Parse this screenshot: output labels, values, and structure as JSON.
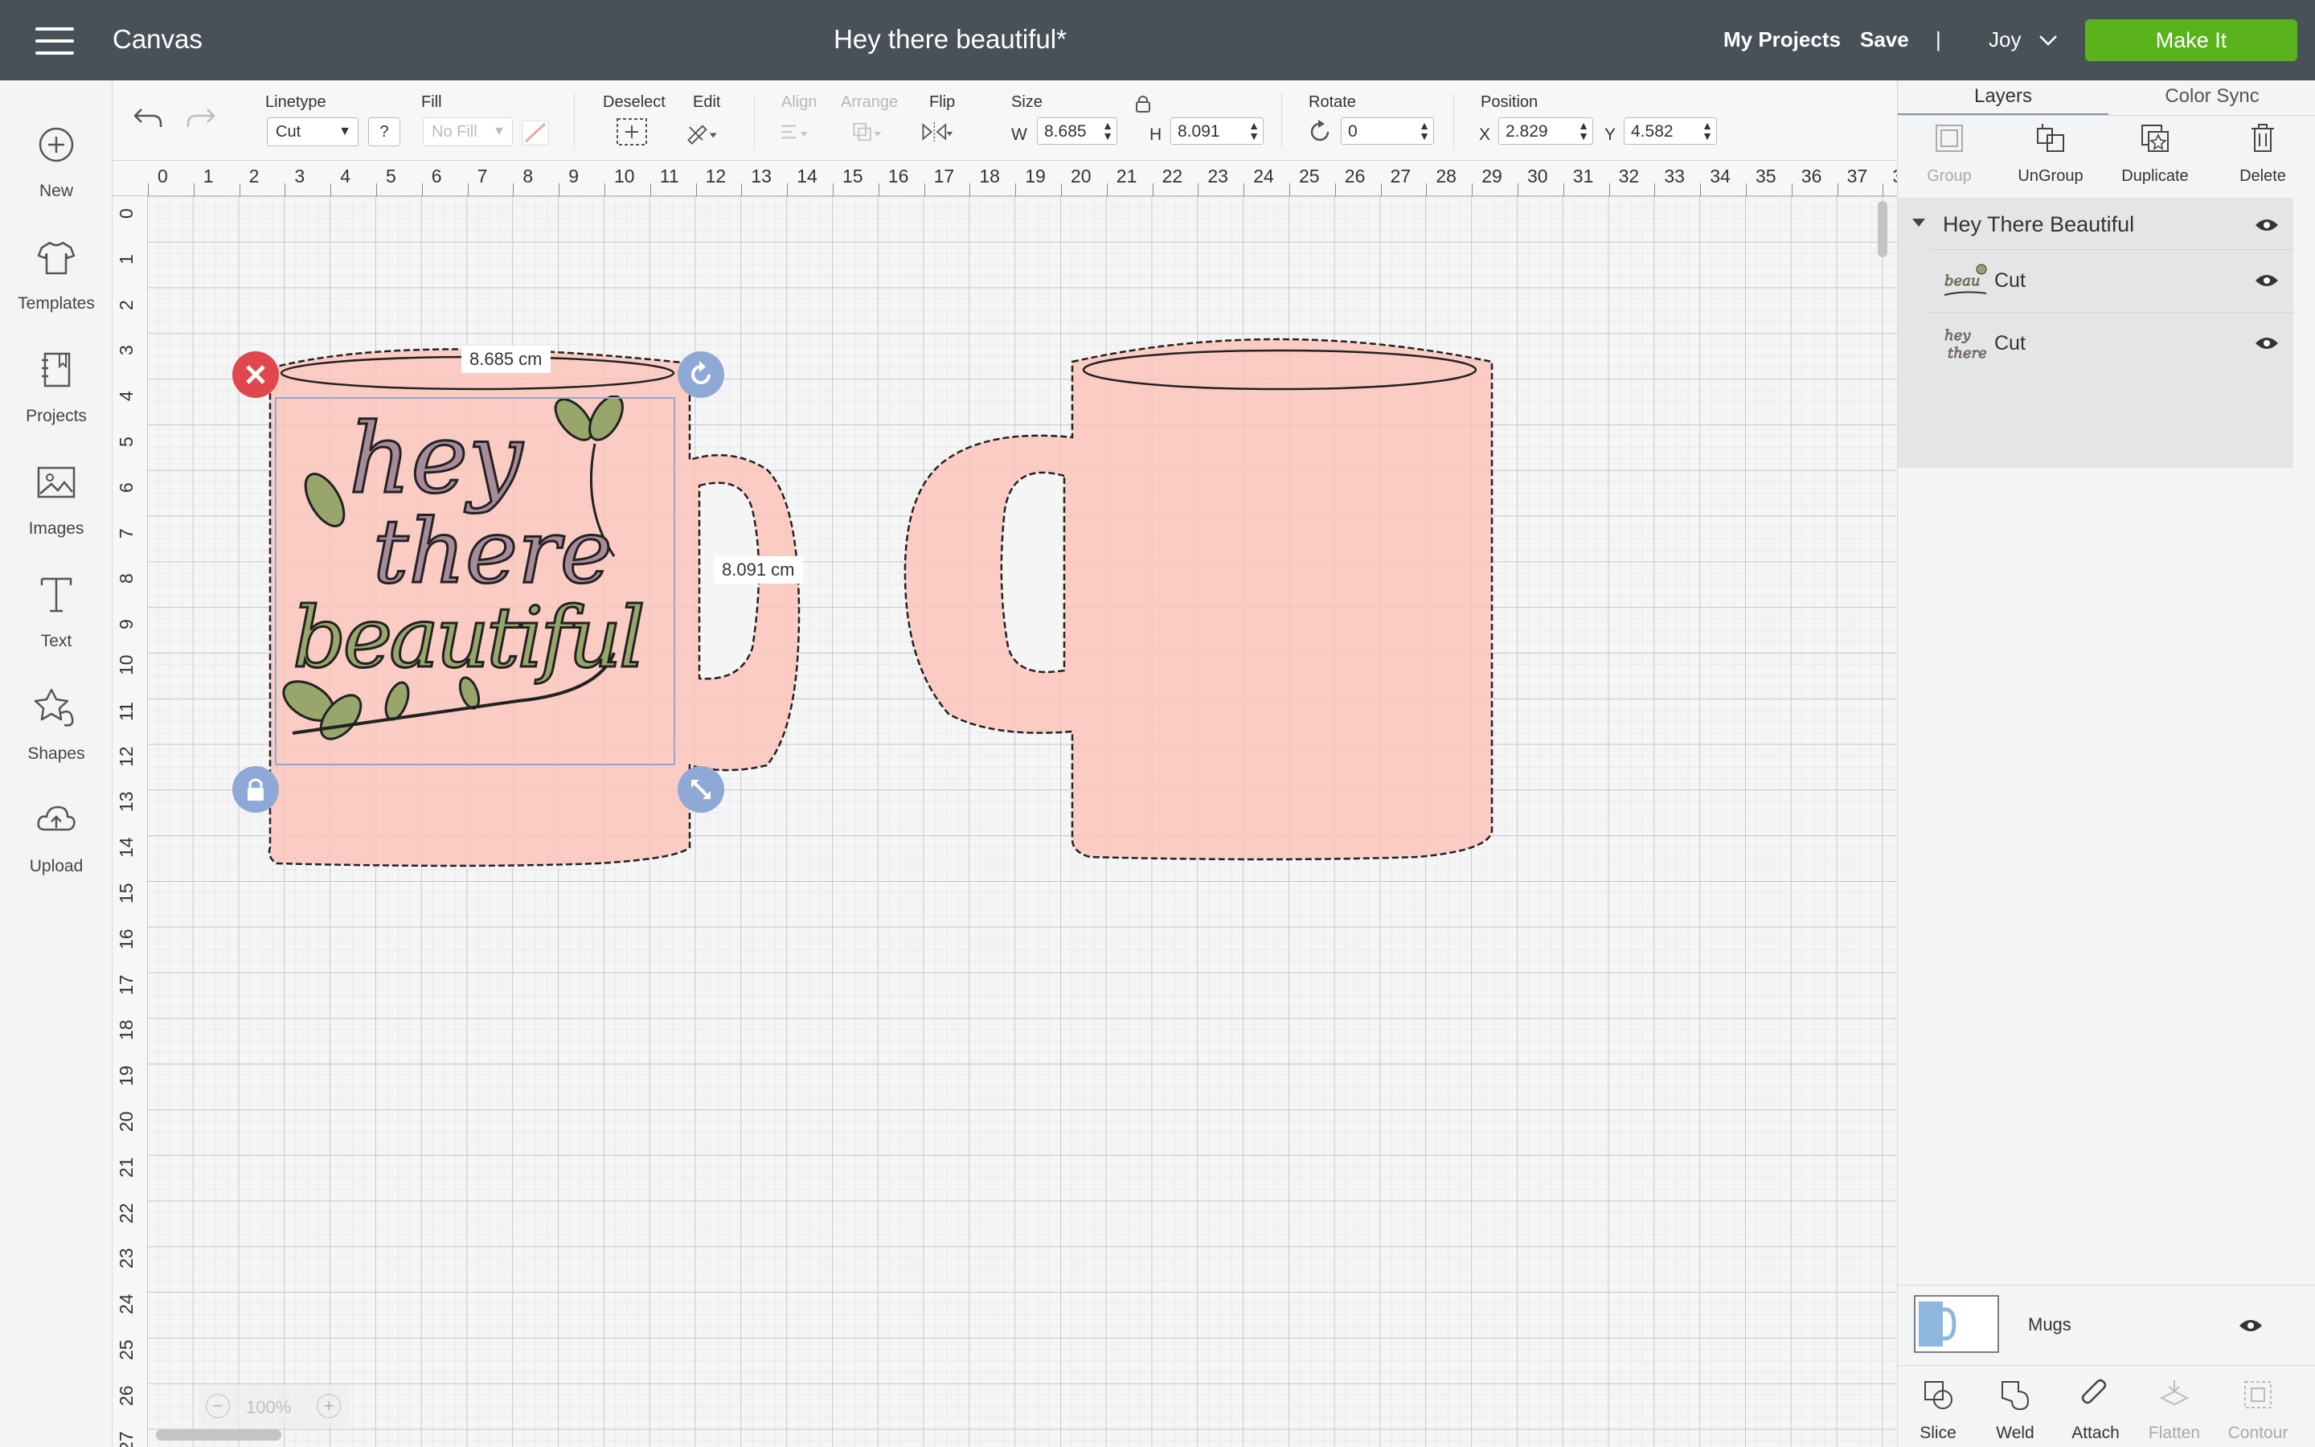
{
  "header": {
    "app_title": "Canvas",
    "doc_title": "Hey there beautiful*",
    "my_projects": "My Projects",
    "save": "Save",
    "divider": "|",
    "user": "Joy",
    "make_it": "Make It",
    "make_it_color": "#5ab31a"
  },
  "sidebar": {
    "items": [
      {
        "label": "New",
        "icon": "plus-circle-icon"
      },
      {
        "label": "Templates",
        "icon": "tshirt-icon"
      },
      {
        "label": "Projects",
        "icon": "notebook-icon"
      },
      {
        "label": "Images",
        "icon": "image-icon"
      },
      {
        "label": "Text",
        "icon": "text-t-icon"
      },
      {
        "label": "Shapes",
        "icon": "shapes-icon"
      },
      {
        "label": "Upload",
        "icon": "cloud-upload-icon"
      }
    ]
  },
  "toolbar": {
    "linetype_label": "Linetype",
    "linetype_value": "Cut",
    "help": "?",
    "fill_label": "Fill",
    "fill_value": "No Fill",
    "deselect_label": "Deselect",
    "edit_label": "Edit",
    "align_label": "Align",
    "arrange_label": "Arrange",
    "flip_label": "Flip",
    "size_label": "Size",
    "w_label": "W",
    "w_value": "8.685",
    "h_label": "H",
    "h_value": "8.091",
    "rotate_label": "Rotate",
    "rotate_value": "0",
    "position_label": "Position",
    "x_label": "X",
    "x_value": "2.829",
    "y_label": "Y",
    "y_value": "4.582"
  },
  "canvas": {
    "ruler_top": [
      "0",
      "1",
      "2",
      "3",
      "4",
      "5",
      "6",
      "7",
      "8",
      "9",
      "10",
      "11",
      "12",
      "13",
      "14",
      "15",
      "16",
      "17",
      "18",
      "19",
      "20",
      "21",
      "22",
      "23",
      "24",
      "25",
      "26",
      "27",
      "28",
      "29",
      "30",
      "31",
      "32",
      "33",
      "34",
      "35",
      "36",
      "37",
      "3"
    ],
    "ruler_left": [
      "0",
      "1",
      "2",
      "3",
      "4",
      "5",
      "6",
      "7",
      "8",
      "9",
      "10",
      "11",
      "12",
      "13",
      "14",
      "15",
      "16",
      "17",
      "18",
      "19",
      "20",
      "21",
      "22",
      "23",
      "24",
      "25",
      "26",
      "27"
    ],
    "width_tag": "8.685 cm",
    "height_tag": "8.091 cm",
    "design_text": [
      "hey",
      "there",
      "beautiful"
    ],
    "mug_color": "#fcc2b8",
    "selection_color": "#8ea9d6",
    "zoom": "100%"
  },
  "panel": {
    "tabs": [
      "Layers",
      "Color Sync"
    ],
    "actions": [
      {
        "label": "Group",
        "icon": "group-icon",
        "enabled": false
      },
      {
        "label": "UnGroup",
        "icon": "ungroup-icon",
        "enabled": true
      },
      {
        "label": "Duplicate",
        "icon": "duplicate-icon",
        "enabled": true
      },
      {
        "label": "Delete",
        "icon": "trash-icon",
        "enabled": true
      }
    ],
    "group_name": "Hey There Beautiful",
    "layers": [
      {
        "name": "Cut"
      },
      {
        "name": "Cut"
      }
    ],
    "mugs_layer": "Mugs",
    "bottom_actions": [
      {
        "label": "Slice",
        "icon": "slice-icon",
        "enabled": true
      },
      {
        "label": "Weld",
        "icon": "weld-icon",
        "enabled": true
      },
      {
        "label": "Attach",
        "icon": "paperclip-icon",
        "enabled": true
      },
      {
        "label": "Flatten",
        "icon": "flatten-icon",
        "enabled": false
      },
      {
        "label": "Contour",
        "icon": "contour-icon",
        "enabled": false
      }
    ]
  }
}
